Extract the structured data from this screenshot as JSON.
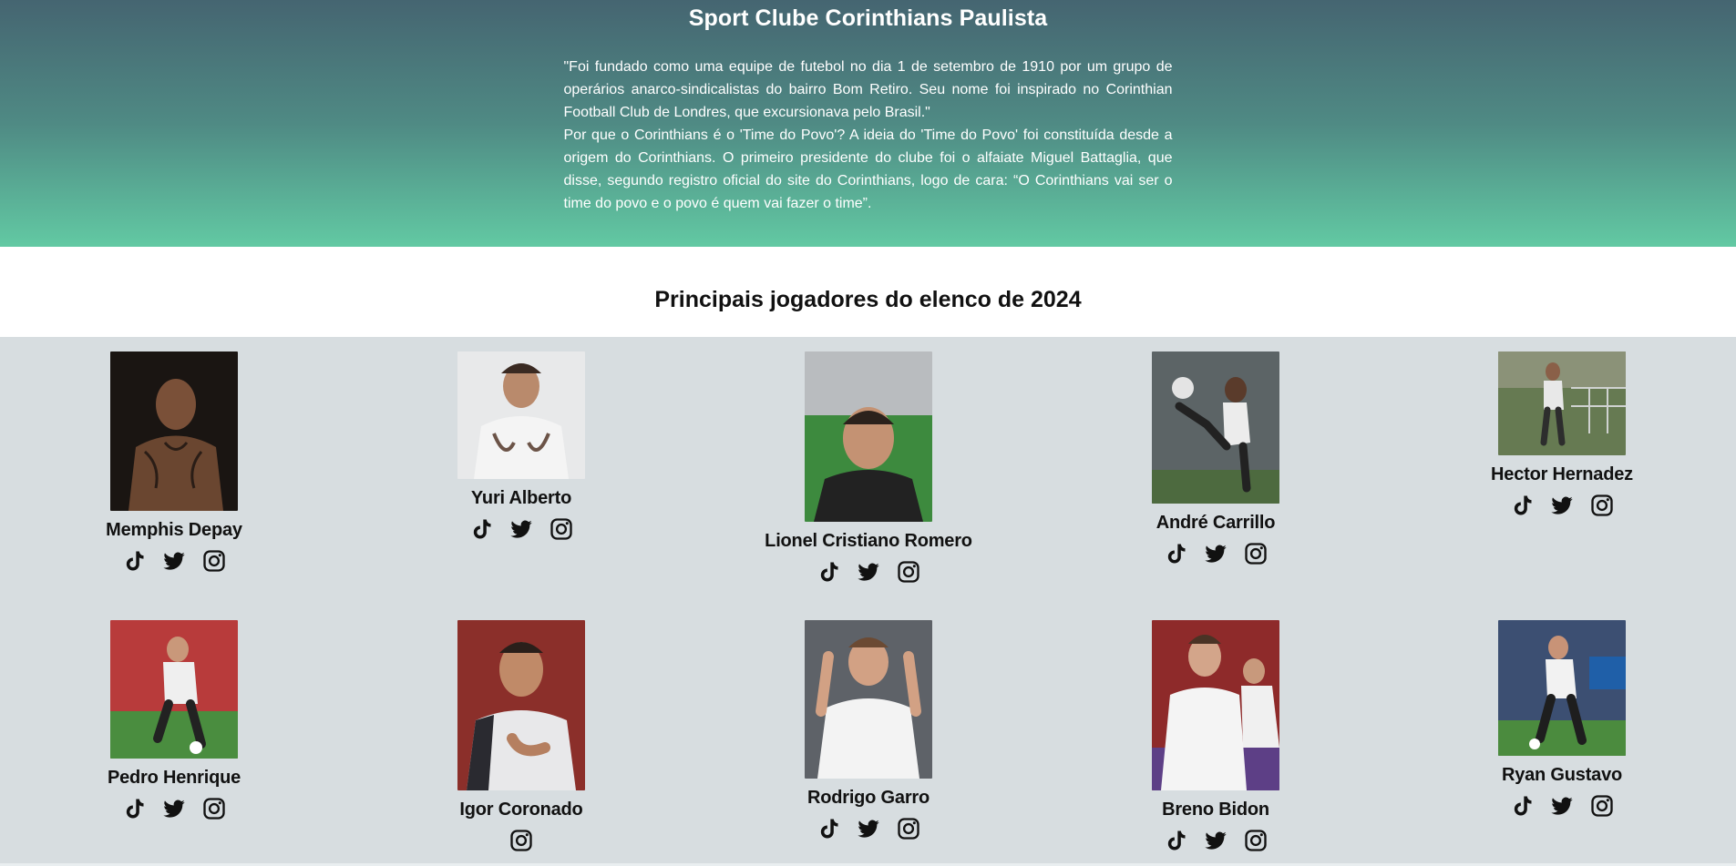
{
  "header": {
    "title": "Sport Clube Corinthians Paulista",
    "paragraph1": "\"Foi fundado como uma equipe de futebol no dia 1 de setembro de 1910 por um grupo de operários anarco-sindicalistas do bairro Bom Retiro. Seu nome foi inspirado no Corinthian Football Club de Londres, que excursionava pelo Brasil.\"",
    "paragraph2": "Por que o Corinthians é o 'Time do Povo'? A ideia do 'Time do Povo' foi constituída desde a origem do Corinthians. O primeiro presidente do clube foi o alfaiate Miguel Battaglia, que disse, segundo registro oficial do site do Corinthians, logo de cara: “O Corinthians vai ser o time do povo e o povo é quem vai fazer o time”."
  },
  "section": {
    "title": "Principais jogadores do elenco de 2024"
  },
  "players": [
    {
      "name": "Memphis Depay",
      "icons": [
        "tiktok-icon",
        "twitter-icon",
        "instagram-icon"
      ]
    },
    {
      "name": "Yuri Alberto",
      "icons": [
        "tiktok-icon",
        "twitter-icon",
        "instagram-icon"
      ]
    },
    {
      "name": "Lionel Cristiano Romero",
      "icons": [
        "tiktok-icon",
        "twitter-icon",
        "instagram-icon"
      ]
    },
    {
      "name": "André Carrillo",
      "icons": [
        "tiktok-icon",
        "twitter-icon",
        "instagram-icon"
      ]
    },
    {
      "name": "Hector Hernadez",
      "icons": [
        "tiktok-icon",
        "twitter-icon",
        "instagram-icon"
      ]
    },
    {
      "name": "Pedro Henrique",
      "icons": [
        "tiktok-icon",
        "twitter-icon",
        "instagram-icon"
      ]
    },
    {
      "name": "Igor Coronado",
      "icons": [
        "instagram-icon"
      ]
    },
    {
      "name": "Rodrigo Garro",
      "icons": [
        "tiktok-icon",
        "twitter-icon",
        "instagram-icon"
      ]
    },
    {
      "name": "Breno Bidon",
      "icons": [
        "tiktok-icon",
        "twitter-icon",
        "instagram-icon"
      ]
    },
    {
      "name": "Ryan Gustavo",
      "icons": [
        "tiktok-icon",
        "twitter-icon",
        "instagram-icon"
      ]
    }
  ]
}
